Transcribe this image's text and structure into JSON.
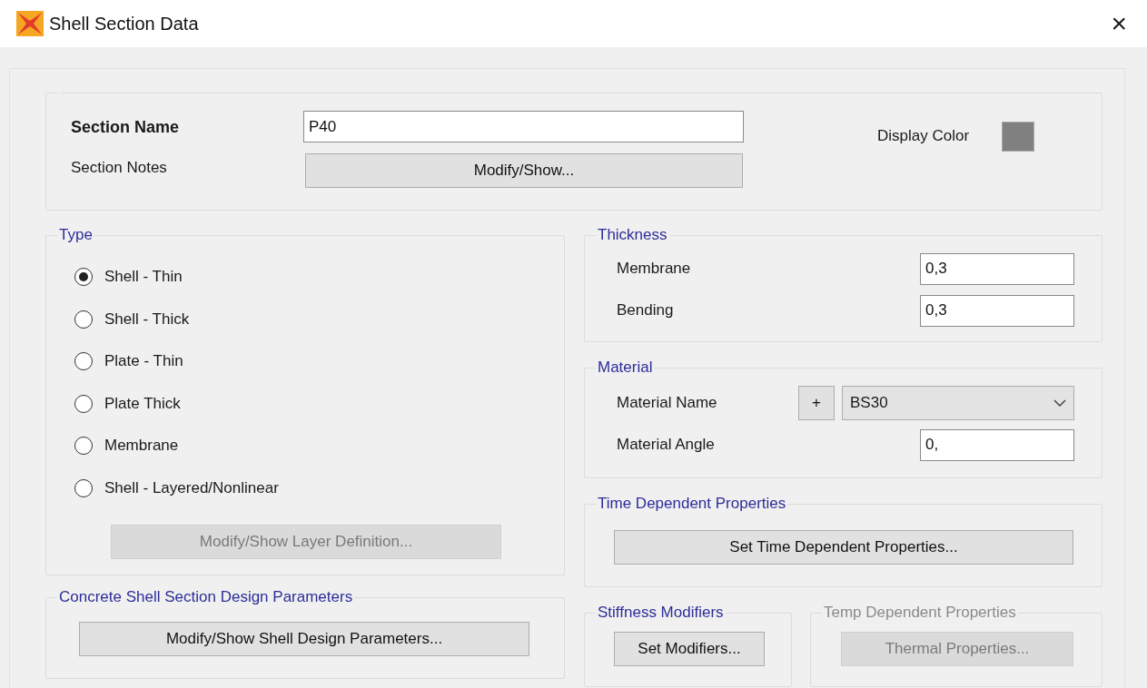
{
  "window": {
    "title": "Shell Section Data",
    "close": "×"
  },
  "section": {
    "name_label": "Section Name",
    "name_value": "P40",
    "notes_label": "Section Notes",
    "notes_button": "Modify/Show...",
    "display_color_label": "Display Color",
    "color": "#808080"
  },
  "type": {
    "title": "Type",
    "options": [
      {
        "label": "Shell - Thin",
        "selected": true
      },
      {
        "label": "Shell - Thick",
        "selected": false
      },
      {
        "label": "Plate - Thin",
        "selected": false
      },
      {
        "label": "Plate Thick",
        "selected": false
      },
      {
        "label": "Membrane",
        "selected": false
      },
      {
        "label": "Shell - Layered/Nonlinear",
        "selected": false
      }
    ],
    "layer_button": {
      "label": "Modify/Show Layer Definition...",
      "disabled": true
    }
  },
  "thickness": {
    "title": "Thickness",
    "fields": [
      {
        "label": "Membrane",
        "value": "0,3"
      },
      {
        "label": "Bending",
        "value": "0,3"
      }
    ]
  },
  "material": {
    "title": "Material",
    "name_label": "Material Name",
    "add_button": "+",
    "name_value": "BS30",
    "angle_label": "Material Angle",
    "angle_value": "0,"
  },
  "time_dependent": {
    "title": "Time Dependent Properties",
    "button": "Set Time Dependent Properties..."
  },
  "concrete": {
    "title": "Concrete Shell Section Design Parameters",
    "button": "Modify/Show Shell Design Parameters..."
  },
  "stiffness": {
    "title": "Stiffness Modifiers",
    "button": "Set Modifiers..."
  },
  "temp": {
    "title": "Temp Dependent Properties",
    "button": "Thermal Properties...",
    "disabled": true
  }
}
